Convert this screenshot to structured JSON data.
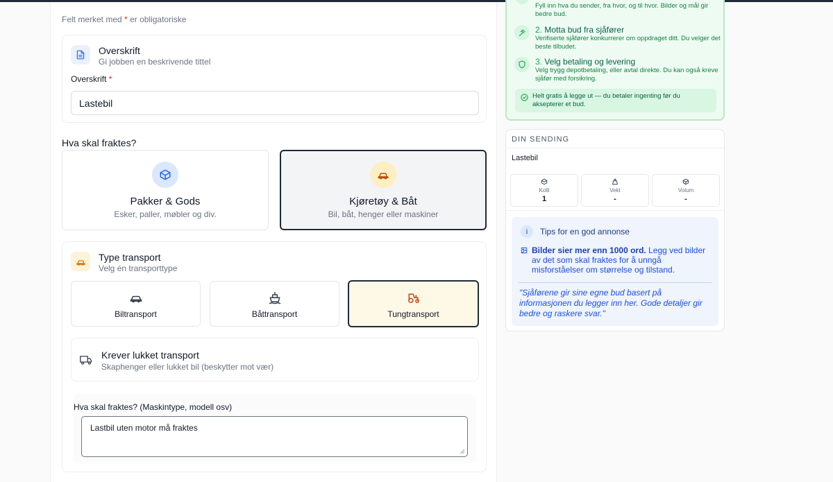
{
  "form": {
    "required_note": "Felt merket med",
    "required_star": "*",
    "required_note_end": "er obligatoriske",
    "headline_section": {
      "title": "Overskrift",
      "subtitle": "Gi jobben en beskrivende tittel",
      "field_label": "Overskrift",
      "field_value": "Lastebil"
    },
    "what_label": "Hva skal fraktes?",
    "categories": [
      {
        "title": "Pakker & Gods",
        "subtitle": "Esker, paller, møbler og div.",
        "selected": false
      },
      {
        "title": "Kjøretøy & Båt",
        "subtitle": "Bil, båt, henger eller maskiner",
        "selected": true
      }
    ],
    "transport_section": {
      "title": "Type transport",
      "subtitle": "Velg én transporttype",
      "options": [
        {
          "label": "Biltransport",
          "selected": false
        },
        {
          "label": "Båttransport",
          "selected": false
        },
        {
          "label": "Tungtransport",
          "selected": true
        }
      ]
    },
    "closed_transport": {
      "title": "Krever lukket transport",
      "subtitle": "Skaphenger eller lukket bil (beskytter mot vær)"
    },
    "machine_field": {
      "label": "Hva skal fraktes? (Maskintype, modell osv)",
      "value": "Lastbil uten motor må fraktes"
    }
  },
  "sidebar": {
    "steps": {
      "step1_desc": "Fyll inn hva du sender, fra hvor, og til hvor. Bilder og mål gir bedre bud.",
      "step2_num": "2.",
      "step2_title": "Motta bud fra sjåfører",
      "step2_desc": "Verifiserte sjåfører konkurrerer om oppdraget ditt. Du velger det beste tilbudet.",
      "step3_num": "3.",
      "step3_title": "Velg betaling og levering",
      "step3_desc": "Velg trygg depotbetaling, eller avtal direkte. Du kan også kreve sjåfør med forsikring.",
      "free_note": "Helt gratis å legge ut — du betaler ingenting før du aksepterer et bud."
    },
    "shipment": {
      "heading": "DIN SENDING",
      "name": "Lastebil",
      "stats": [
        {
          "label": "Kolli",
          "value": "1"
        },
        {
          "label": "Vekt",
          "value": "-"
        },
        {
          "label": "Volum",
          "value": "-"
        }
      ],
      "tips_icon": "i",
      "tips_title": "Tips for en god annonse",
      "tip_bold": "Bilder sier mer enn 1000 ord.",
      "tip_text": "Legg ved bilder av det som skal fraktes for å unngå misforståelser om størrelse og tilstand.",
      "quote": "\"Sjåførene gir sine egne bud basert på informasjonen du legger inn her. Gode detaljer gir bedre og raskere svar.\""
    }
  },
  "icons": {
    "document": "document-icon",
    "box": "box-icon",
    "car": "car-icon",
    "boat": "boat-icon",
    "tractor": "tractor-icon",
    "truck": "truck-icon",
    "gavel": "gavel-icon",
    "shield": "shield-icon",
    "check": "check-circle-icon",
    "image": "image-icon"
  },
  "colors": {
    "accent_green": "#16a34a",
    "accent_blue": "#1d4ed8",
    "selected_border": "#1f2937",
    "required": "#dc2626"
  }
}
